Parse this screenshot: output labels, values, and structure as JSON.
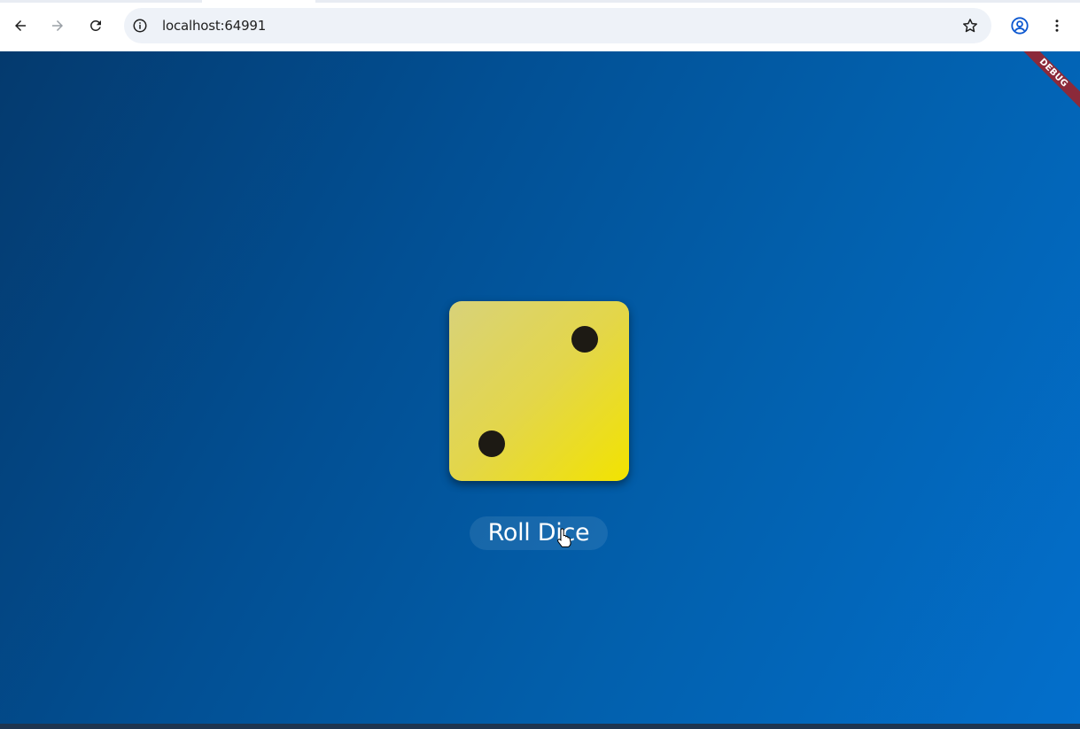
{
  "browser": {
    "url": "localhost:64991",
    "icons": {
      "back": "arrow-left-icon",
      "forward": "arrow-right-icon",
      "reload": "reload-icon",
      "site_info": "info-icon",
      "bookmark": "star-icon",
      "profile": "profile-icon",
      "menu": "kebab-menu-icon"
    }
  },
  "app": {
    "debug_banner": "DEBUG",
    "die": {
      "face_value": 2,
      "color": "#e3d64a",
      "pip_color": "#1d1a14"
    },
    "roll_button_label": "Roll Dice",
    "background_colors": [
      "#043a6e",
      "#036fcc"
    ]
  }
}
